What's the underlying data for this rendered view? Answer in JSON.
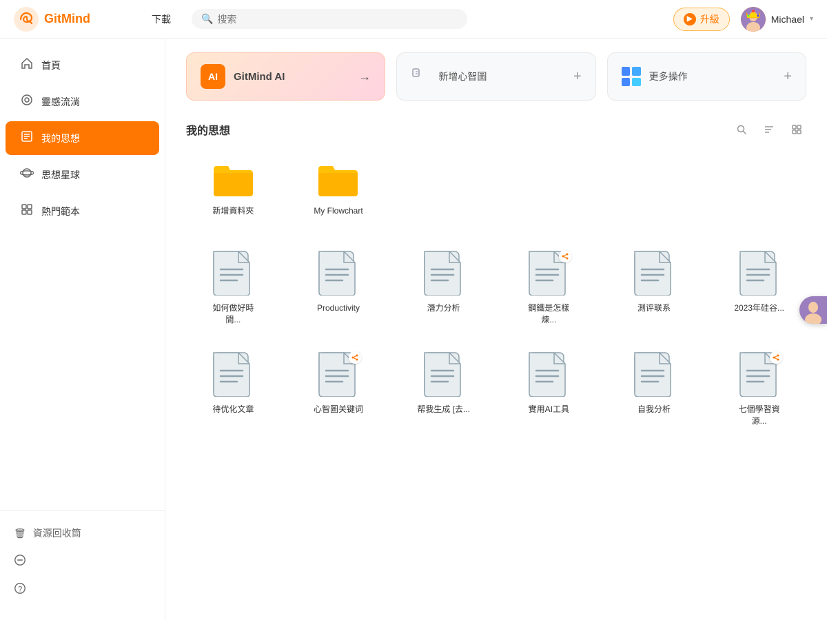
{
  "header": {
    "logo_text": "GitMind",
    "nav": [
      {
        "label": "下載"
      }
    ],
    "search_placeholder": "搜索",
    "upgrade_label": "升級",
    "user_name": "Michael"
  },
  "sidebar": {
    "items": [
      {
        "id": "home",
        "label": "首頁",
        "icon": "🏠"
      },
      {
        "id": "inspiration",
        "label": "靈感流淌",
        "icon": "💡"
      },
      {
        "id": "mythoughts",
        "label": "我的思想",
        "icon": "📋",
        "active": true
      },
      {
        "id": "planet",
        "label": "思想星球",
        "icon": "🪐"
      },
      {
        "id": "templates",
        "label": "熱門範本",
        "icon": "⊞"
      }
    ],
    "footer": [
      {
        "id": "trash",
        "label": "資源回收筒",
        "icon": "🗑"
      },
      {
        "id": "chat",
        "label": "聊天",
        "icon": "💬"
      },
      {
        "id": "help",
        "label": "幫助",
        "icon": "❓"
      }
    ]
  },
  "quick_actions": [
    {
      "id": "ai",
      "label": "GitMind AI",
      "type": "ai",
      "icon_text": "AI"
    },
    {
      "id": "new_mind",
      "label": "新增心智圖",
      "type": "new"
    },
    {
      "id": "more_ops",
      "label": "更多操作",
      "type": "more"
    }
  ],
  "section_title": "我的思想",
  "folders": [
    {
      "id": "new_folder",
      "label": "新增資料夾"
    },
    {
      "id": "flowchart",
      "label": "My Flowchart"
    }
  ],
  "files": [
    {
      "id": "f1",
      "label": "如何做好時間...",
      "shared": false
    },
    {
      "id": "f2",
      "label": "Productivity",
      "shared": false
    },
    {
      "id": "f3",
      "label": "潛力分析",
      "shared": false
    },
    {
      "id": "f4",
      "label": "鋼鐵是怎樣煉...",
      "shared": true
    },
    {
      "id": "f5",
      "label": "測评联系",
      "shared": false
    },
    {
      "id": "f6",
      "label": "2023年硅谷...",
      "shared": false
    },
    {
      "id": "f7",
      "label": "待优化文章",
      "shared": false
    },
    {
      "id": "f8",
      "label": "心智圖关键词",
      "shared": true
    },
    {
      "id": "f9",
      "label": "帮我生成 [去...",
      "shared": false
    },
    {
      "id": "f10",
      "label": "實用AI工具",
      "shared": false
    },
    {
      "id": "f11",
      "label": "自我分析",
      "shared": false
    },
    {
      "id": "f12",
      "label": "七個學習資源...",
      "shared": true
    }
  ]
}
